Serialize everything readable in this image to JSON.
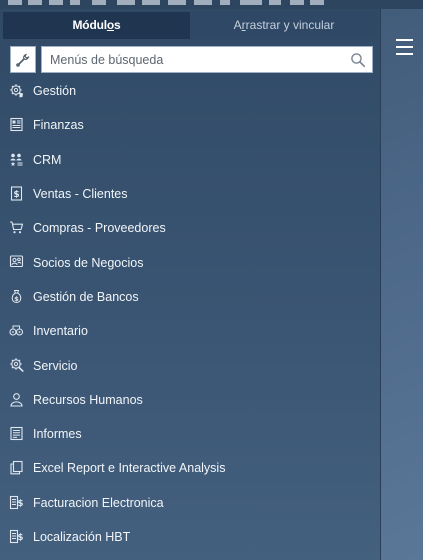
{
  "tabs": {
    "modulos": {
      "pre": "Módul",
      "ul": "o",
      "post": "s"
    },
    "arrastrar": {
      "pre": "A",
      "ul": "r",
      "post": "rastrar y vincular"
    }
  },
  "search": {
    "placeholder": "Menús de búsqueda",
    "value": ""
  },
  "menu": {
    "items": [
      {
        "label": "Gestión",
        "icon": "gear-shield-icon"
      },
      {
        "label": "Finanzas",
        "icon": "ledger-icon"
      },
      {
        "label": "CRM",
        "icon": "people-star-icon"
      },
      {
        "label": "Ventas - Clientes",
        "icon": "dollar-document-icon"
      },
      {
        "label": "Compras - Proveedores",
        "icon": "cart-icon"
      },
      {
        "label": "Socios de Negocios",
        "icon": "contacts-icon"
      },
      {
        "label": "Gestión de Bancos",
        "icon": "money-bag-icon"
      },
      {
        "label": "Inventario",
        "icon": "boxes-icon"
      },
      {
        "label": "Servicio",
        "icon": "gear-wrench-icon"
      },
      {
        "label": "Recursos Humanos",
        "icon": "person-icon"
      },
      {
        "label": "Informes",
        "icon": "report-icon"
      },
      {
        "label": "Excel Report e Interactive Analysis",
        "icon": "copy-documents-icon"
      },
      {
        "label": "Facturacion Electronica",
        "icon": "invoice-dollar-icon"
      },
      {
        "label": "Localización HBT",
        "icon": "localization-icon"
      }
    ]
  },
  "colors": {
    "tab_active_bg": "#1f3550",
    "panel_bg": "#304a66",
    "text": "#f2f5f8"
  }
}
